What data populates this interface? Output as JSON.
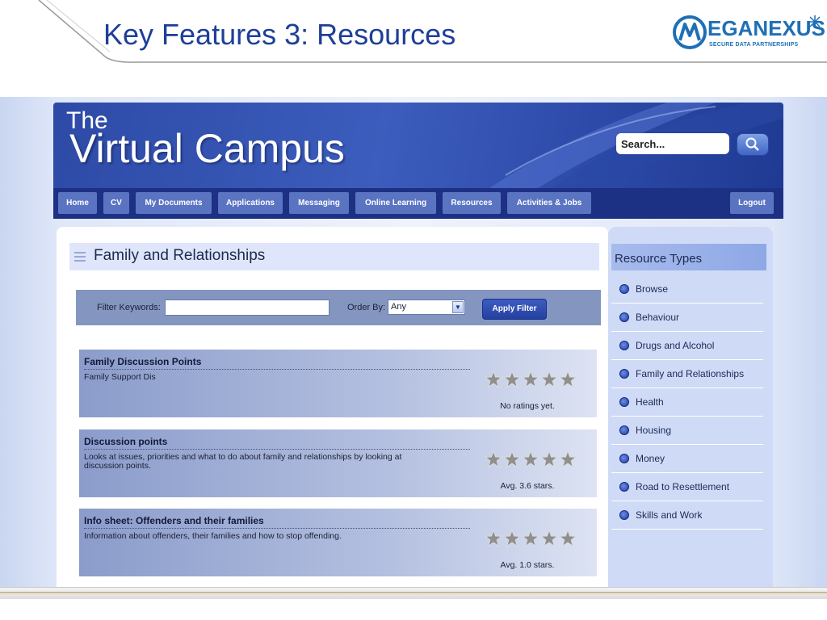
{
  "slide": {
    "title": "Key Features 3: Resources",
    "logo_text": "EGANEXUS",
    "logo_tagline": "SECURE DATA PARTNERSHIPS"
  },
  "site": {
    "brand_small": "The",
    "brand_large": "Virtual Campus",
    "search_placeholder": "Search...",
    "nav": [
      {
        "label": "Home"
      },
      {
        "label": "CV"
      },
      {
        "label": "My Documents"
      },
      {
        "label": "Applications"
      },
      {
        "label": "Messaging"
      },
      {
        "label": "Online Learning"
      },
      {
        "label": "Resources"
      },
      {
        "label": "Activities & Jobs"
      },
      {
        "label": "Logout"
      }
    ]
  },
  "page": {
    "section_title": "Family and Relationships",
    "filter": {
      "keywords_label": "Filter Keywords:",
      "keywords_value": "",
      "order_label": "Order By:",
      "order_value": "Any",
      "apply_label": "Apply Filter"
    },
    "resources": [
      {
        "title": "Family Discussion Points",
        "description": "Family Support Dis",
        "rating_text": "No ratings yet.",
        "rating": 0
      },
      {
        "title": "Discussion points",
        "description": "Looks at issues, priorities and what to do about family and relationships by looking at discussion points.",
        "rating_text": "Avg. 3.6 stars.",
        "rating": 3.6
      },
      {
        "title": "Info sheet: Offenders and their families",
        "description": "Information about offenders, their families and how to stop offending.",
        "rating_text": "Avg. 1.0 stars.",
        "rating": 1.0
      }
    ]
  },
  "sidebar": {
    "title": "Resource Types",
    "items": [
      {
        "label": "Browse"
      },
      {
        "label": "Behaviour"
      },
      {
        "label": "Drugs and Alcohol"
      },
      {
        "label": "Family and Relationships"
      },
      {
        "label": "Health"
      },
      {
        "label": "Housing"
      },
      {
        "label": "Money"
      },
      {
        "label": "Road to Resettlement"
      },
      {
        "label": "Skills and Work"
      }
    ]
  },
  "colors": {
    "title_blue": "#1e3f98",
    "nav_bg": "#1d3184",
    "nav_item": "#5a74c2",
    "star_gray": "#8f8f8f"
  }
}
